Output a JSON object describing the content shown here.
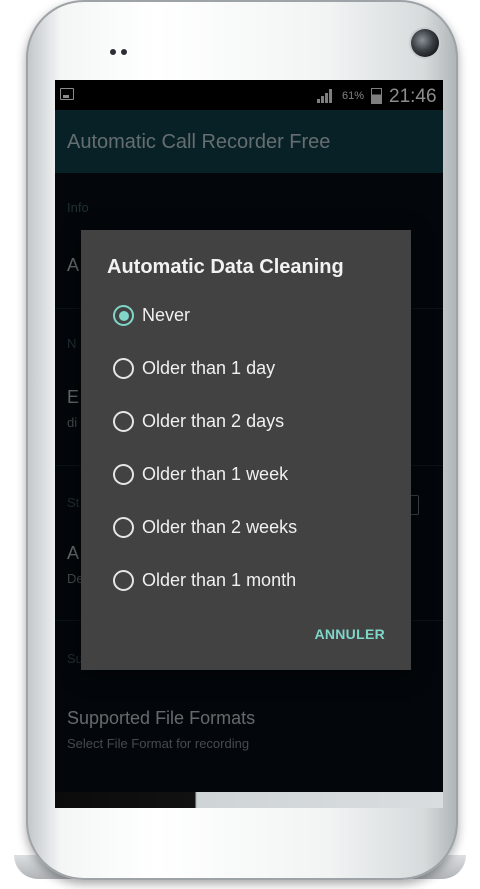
{
  "status_bar": {
    "battery_percent": "61%",
    "time": "21:46",
    "left_icon": "image-notification-icon"
  },
  "app": {
    "title": "Automatic Call Recorder Free"
  },
  "settings": {
    "info_category": "Info",
    "first_pref_letter": "A",
    "category2": "N",
    "enable_title_fragment": "E",
    "enable_summary_fragment": "di",
    "category3": "St",
    "pref3_title_fragment": "A",
    "pref3_summary_fragment": "De",
    "category4": "Su",
    "supported_formats_title": "Supported File Formats",
    "supported_formats_summary": "Select File Format for recording"
  },
  "dialog": {
    "title": "Automatic Data Cleaning",
    "options": [
      {
        "label": "Never",
        "selected": true
      },
      {
        "label": "Older than 1 day",
        "selected": false
      },
      {
        "label": "Older than 2 days",
        "selected": false
      },
      {
        "label": "Older than 1 week",
        "selected": false
      },
      {
        "label": "Older than 2 weeks",
        "selected": false
      },
      {
        "label": "Older than 1 month",
        "selected": false
      }
    ],
    "cancel_label": "ANNULER"
  },
  "colors": {
    "accent": "#7fd6c9",
    "appbar": "#0f3d48",
    "dialog_bg": "#424242"
  }
}
